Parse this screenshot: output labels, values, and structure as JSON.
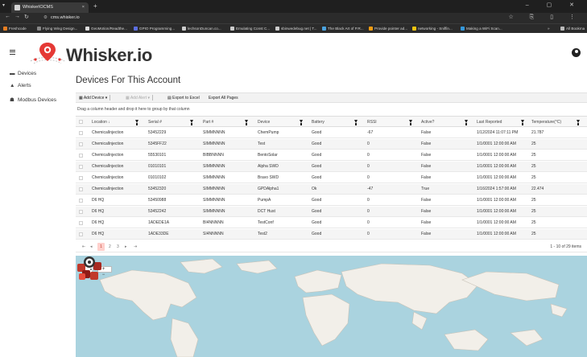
{
  "browser": {
    "tab_title": "WhiskerIOCMS",
    "url": "cms.whisker.io",
    "bookmarks": [
      "Freshcode",
      "Flying Wing Design...",
      "GeoMotion/Readthe...",
      "GPIO Programming...",
      "lechsonDuncan.co...",
      "Emulating Const C...",
      "sbinwedebug.net | T...",
      "The Black Art of P.R...",
      "Provide pointer ad...",
      "networking - Sniffin...",
      "Making a WiFi Scan..."
    ],
    "all_bookmarks": "All Bookma"
  },
  "header": {
    "brand": "Whisker.io"
  },
  "sidebar": {
    "items": [
      {
        "label": "Devices",
        "icon": "devices-icon"
      },
      {
        "label": "Alerts",
        "icon": "warning-icon"
      },
      {
        "label": "Modbus Devices",
        "icon": "network-icon"
      }
    ]
  },
  "main": {
    "title": "Devices For This Account",
    "toolbar": {
      "add_device": "Add Device",
      "add_alert": "Add Alert",
      "export_excel": "Export to Excel",
      "export_all": "Export All Pages"
    },
    "group_hint": "Drag a column header and drop it here to group by that column",
    "columns": [
      "Location",
      "Serial #",
      "Part #",
      "Device",
      "Battery",
      "RSSI",
      "Active?",
      "Last Reported",
      "Temperature(°C)"
    ],
    "rows": [
      [
        "ChemicalInjection",
        "53452229",
        "SIMMNNNN",
        "ChemPump",
        "Good",
        "-67",
        "False",
        "1/12/2024 11:07:11 PM",
        "21.787"
      ],
      [
        "ChemicalInjection",
        "5345FF22",
        "SIMMNNNN",
        "Test",
        "Good",
        "0",
        "False",
        "1/1/0001 12:00:00 AM",
        "25"
      ],
      [
        "ChemicalInjection",
        "55530101",
        "BIBBNNNN",
        "BentoSolar",
        "Good",
        "0",
        "False",
        "1/1/0001 12:00:00 AM",
        "25"
      ],
      [
        "ChemicalInjection",
        "01010101",
        "SIMMNNNN",
        "Alpha SWD",
        "Good",
        "0",
        "False",
        "1/1/0001 12:00:00 AM",
        "25"
      ],
      [
        "ChemicalInjection",
        "01010102",
        "SIMMNNNN",
        "Bravo SWD",
        "Good",
        "0",
        "False",
        "1/1/0001 12:00:00 AM",
        "25"
      ],
      [
        "ChemicalInjection",
        "53452320",
        "SIMMNNNN",
        "GPDAlpha1",
        "Ok",
        "-47",
        "True",
        "1/16/2024 1:57:00 AM",
        "22.474"
      ],
      [
        "D6 HQ",
        "53450988",
        "SIMMNNNN",
        "PumpA",
        "Good",
        "0",
        "False",
        "1/1/0001 12:00:00 AM",
        "25"
      ],
      [
        "D6 HQ",
        "53452242",
        "SIMMNNNN",
        "DCT Hust",
        "Good",
        "0",
        "False",
        "1/1/0001 12:00:00 AM",
        "25"
      ],
      [
        "D6 HQ",
        "1ADEDE1A",
        "BI4NNNNN",
        "TestConf",
        "Good",
        "0",
        "False",
        "1/1/0001 12:00:00 AM",
        "25"
      ],
      [
        "D6 HQ",
        "1ADE33DE",
        "SI4NNNNN",
        "Test2",
        "Good",
        "0",
        "False",
        "1/1/0001 12:00:00 AM",
        "25"
      ]
    ],
    "pager": {
      "pages": [
        "1",
        "2",
        "3"
      ],
      "info": "1 - 10 of 29 items"
    },
    "map": {
      "zoom_label": "+ −"
    }
  }
}
